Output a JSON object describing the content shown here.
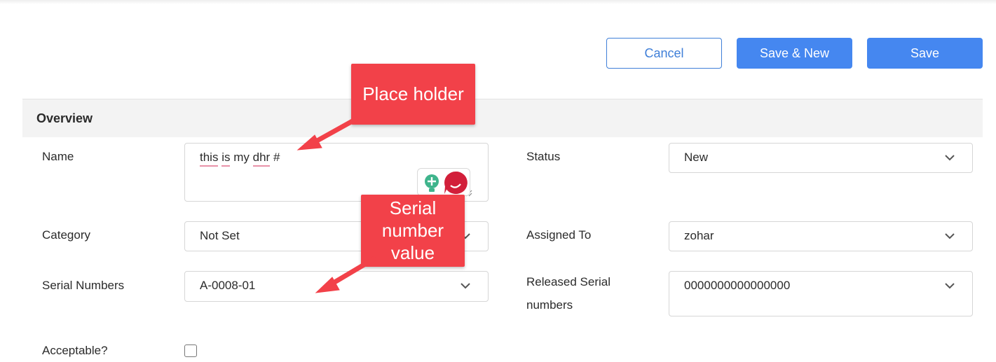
{
  "toolbar": {
    "cancel_label": "Cancel",
    "save_new_label": "Save & New",
    "save_label": "Save"
  },
  "section": {
    "title": "Overview"
  },
  "fields": {
    "name": {
      "label": "Name",
      "value_words": [
        "this",
        "is",
        "my",
        "dhr",
        "#"
      ]
    },
    "status": {
      "label": "Status",
      "value": "New"
    },
    "category": {
      "label": "Category",
      "value": "Not Set"
    },
    "assigned_to": {
      "label": "Assigned To",
      "value": "zohar"
    },
    "serial_numbers": {
      "label": "Serial Numbers",
      "value": "A-0008-01"
    },
    "released_serial_numbers": {
      "label_line1": "Released Serial",
      "label_line2": "numbers",
      "value": "0000000000000000"
    },
    "acceptable": {
      "label": "Acceptable?"
    }
  },
  "annotations": {
    "placeholder_callout": "Place holder",
    "serial_callout_lines": [
      "Serial",
      "number",
      "value"
    ]
  },
  "colors": {
    "primary": "#4587f0",
    "callout": "#f24149",
    "section_bg": "#f3f3f3"
  },
  "icons": {
    "lightbulb": "lightbulb-icon",
    "assistant": "assistant-icon",
    "chevron": "chevron-down-icon"
  }
}
